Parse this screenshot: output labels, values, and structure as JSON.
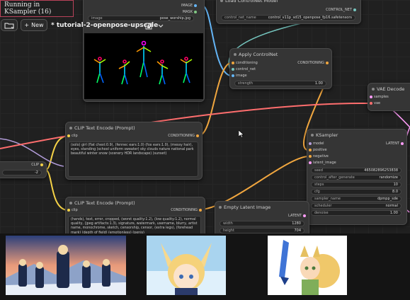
{
  "status": {
    "text": "Running in KSampler (16)"
  },
  "toolbar": {
    "new_label": "New",
    "workflow_title": "* tutorial-2-openpose-upscale"
  },
  "load_image": {
    "image_label": "image",
    "image_value": "pose_worship.jpg",
    "out_image": "IMAGE",
    "out_mask": "MASK"
  },
  "controlnet_loader": {
    "title": "Load ControlNet Model",
    "out_label": "CONTROL_NET",
    "name_label": "control_net_name",
    "name_value": "control_v11p_sd15_openpose_fp16.safetensors"
  },
  "apply_controlnet": {
    "title": "Apply ControlNet",
    "in_conditioning": "conditioning",
    "in_control_net": "control_net",
    "in_image": "image",
    "out_label": "CONDITIONING",
    "strength_label": "strength",
    "strength_value": "1.00"
  },
  "vae_decode": {
    "title": "VAE Decode",
    "in_samples": "samples",
    "in_vae": "vae"
  },
  "clip_positive": {
    "title": "CLIP Text Encode (Prompt)",
    "in_clip": "clip",
    "out_label": "CONDITIONING",
    "text": "(solo) girl (flat chest:0.9), (fennec ears:1.0) (fox ears:1.0), (messy hair), eyes, standing (school uniform sweater) sky clouds nature national park beautiful winter snow (scenery HDR landscape) (sunset)"
  },
  "clip_negative": {
    "title": "CLIP Text Encode (Prompt)",
    "in_clip": "clip",
    "out_label": "CONDITIONING",
    "text": "(hands), text, error, cropped, (worst quality:1.2), (low quality:1.2), normal quality, (jpeg artifacts:1.3), signature, watermark, username, blurry, artist name, monochrome, sketch, censorship, censor, (extra legs), (forehead mark) (depth of field) (emotionless) (penis)"
  },
  "ksampler": {
    "title": "KSampler",
    "in_model": "model",
    "in_positive": "positive",
    "in_negative": "negative",
    "in_latent": "latent_image",
    "out_label": "LATENT",
    "widgets": [
      {
        "label": "seed",
        "value": "465082896253838"
      },
      {
        "label": "control_after_generate",
        "value": "randomize"
      },
      {
        "label": "steps",
        "value": "10"
      },
      {
        "label": "cfg",
        "value": "8.0"
      },
      {
        "label": "sampler_name",
        "value": "dpmpp_sde"
      },
      {
        "label": "scheduler",
        "value": "normal"
      },
      {
        "label": "denoise",
        "value": "1.00"
      }
    ]
  },
  "empty_latent": {
    "title": "Empty Latent Image",
    "out_label": "LATENT",
    "width_label": "width",
    "width_value": "1280",
    "height_label": "height",
    "height_value": "704"
  },
  "clip_loader_stub": {
    "out_clip": "CLIP",
    "value": "-2"
  },
  "colors": {
    "accent_status_border": "#b9425a",
    "conditioning_wire": "#f0a63f",
    "clip_wire": "#f5d247",
    "image_wire": "#64b5f6",
    "vae_wire": "#ff6e6e",
    "latent_wire": "#ff9cf9"
  }
}
